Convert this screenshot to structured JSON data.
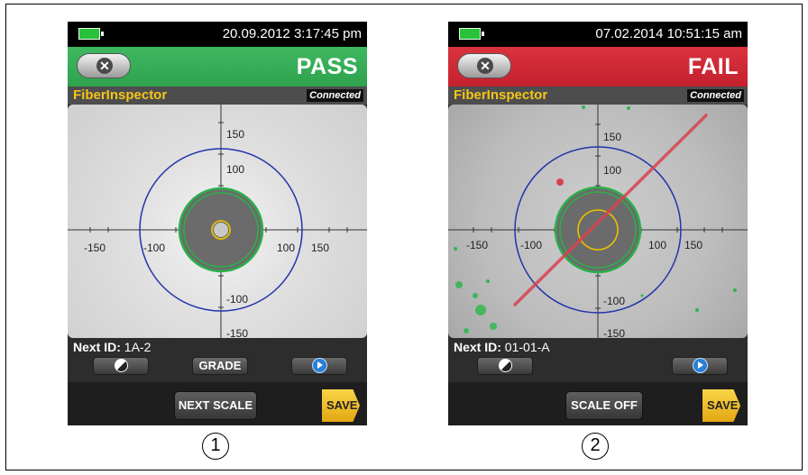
{
  "screens": [
    {
      "timestamp": "20.09.2012 3:17:45 pm",
      "result": "PASS",
      "result_color": "#2ea24d",
      "app_name": "FiberInspector",
      "connection_status": "Connected",
      "next_id_label": "Next ID:",
      "next_id_value": "1A-2",
      "grade_label": "GRADE",
      "scale_button_label": "NEXT SCALE",
      "save_label": "SAVE",
      "scale_labels": {
        "top": "150",
        "up": "100",
        "neg_x_outer": "-150",
        "neg_x_inner": "-100",
        "pos_x_inner": "100",
        "pos_x_outer": "150",
        "down": "-100",
        "bottom": "-150"
      },
      "icons": {
        "back": "close-x-icon",
        "contrast": "contrast-icon",
        "next": "play-icon"
      }
    },
    {
      "timestamp": "07.02.2014 10:51:15 am",
      "result": "FAIL",
      "result_color": "#c4202d",
      "app_name": "FiberInspector",
      "connection_status": "Connected",
      "next_id_label": "Next ID:",
      "next_id_value": "01-01-A",
      "scale_button_label": "SCALE OFF",
      "save_label": "SAVE",
      "scale_labels": {
        "top": "150",
        "up": "100",
        "neg_x_outer": "-150",
        "neg_x_inner": "-100",
        "pos_x_inner": "100",
        "pos_x_outer": "150",
        "down": "-100",
        "bottom": "-150"
      },
      "icons": {
        "back": "close-x-icon",
        "contrast": "contrast-icon",
        "next": "play-icon"
      }
    }
  ],
  "callouts": [
    "1",
    "2"
  ]
}
